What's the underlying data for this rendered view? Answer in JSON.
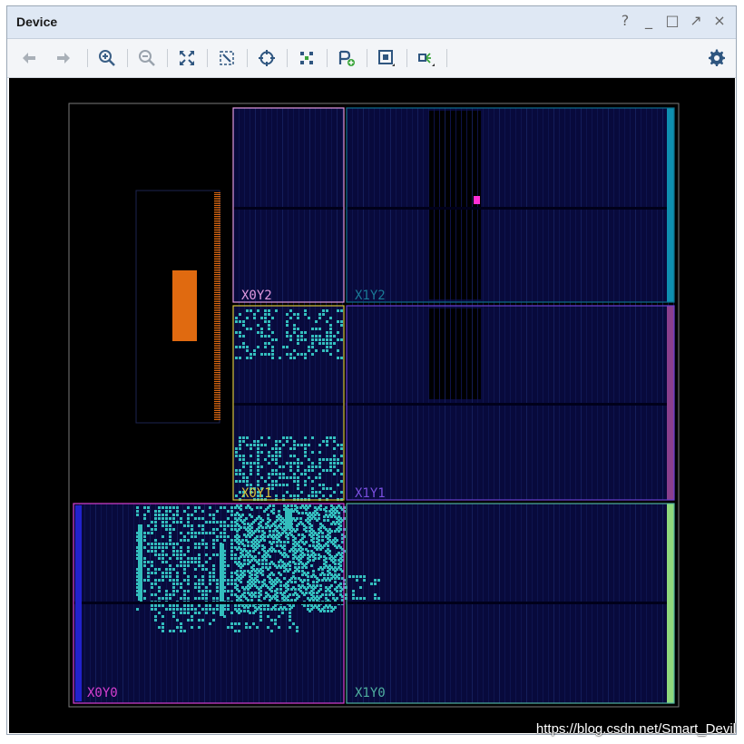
{
  "window": {
    "title": "Device"
  },
  "window_controls": [
    {
      "name": "help-icon",
      "glyph": "?"
    },
    {
      "name": "minimize-icon",
      "glyph": "_"
    },
    {
      "name": "maximize-icon",
      "glyph": "□"
    },
    {
      "name": "float-icon",
      "glyph": "↗"
    },
    {
      "name": "close-icon",
      "glyph": "×"
    }
  ],
  "toolbar": {
    "buttons": [
      {
        "name": "back-button",
        "icon": "arrow-left-icon"
      },
      {
        "name": "forward-button",
        "icon": "arrow-right-icon"
      },
      {
        "name": "zoom-in-button",
        "icon": "zoom-in-icon"
      },
      {
        "name": "zoom-out-button",
        "icon": "zoom-out-icon"
      },
      {
        "name": "zoom-fit-button",
        "icon": "zoom-fit-icon"
      },
      {
        "name": "zoom-selection-button",
        "icon": "zoom-selection-icon"
      },
      {
        "name": "auto-fit-selection-button",
        "icon": "crosshair-icon"
      },
      {
        "name": "route-button",
        "icon": "routing-icon"
      },
      {
        "name": "create-pblock-button",
        "icon": "pblock-add-icon"
      },
      {
        "name": "device-view-options-button",
        "icon": "device-options-icon"
      },
      {
        "name": "show-connections-button",
        "icon": "connections-icon"
      },
      {
        "name": "settings-button",
        "icon": "gear-icon"
      }
    ]
  },
  "clock_regions": [
    {
      "label": "X0Y2",
      "color": "#e29ae0"
    },
    {
      "label": "X1Y2",
      "color": "#0e6f8c"
    },
    {
      "label": "X0Y1",
      "color": "#d8c33a"
    },
    {
      "label": "X1Y1",
      "color": "#6a3fd0"
    },
    {
      "label": "X0Y0",
      "color": "#d63fd0"
    },
    {
      "label": "X1Y0",
      "color": "#4fb0a0"
    }
  ],
  "colors": {
    "background": "#000000",
    "fabric": "#080a3c",
    "placed_cells": "#33bdbd",
    "io_bank": "#e06a10",
    "marker": "#ff2fd6"
  },
  "watermark": "https://blog.csdn.net/Smart_Devil"
}
